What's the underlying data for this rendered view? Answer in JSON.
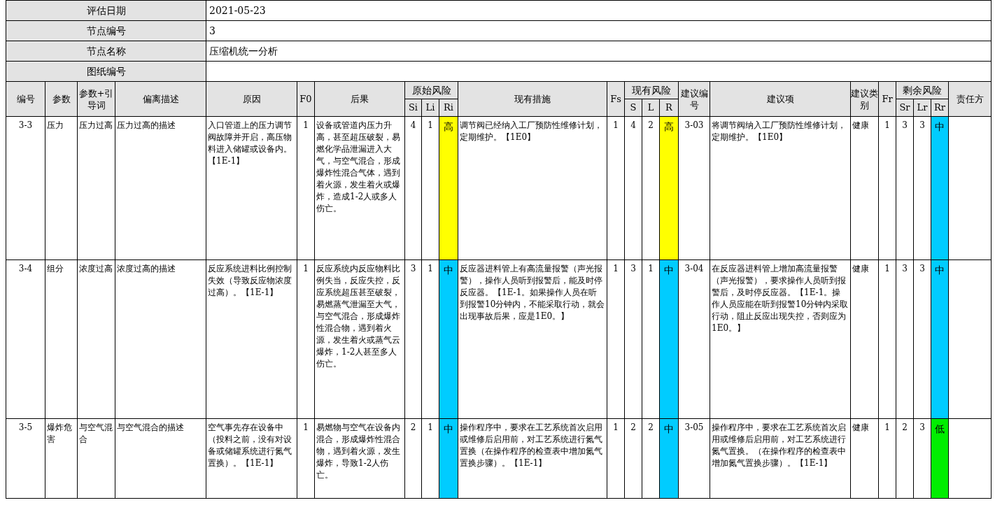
{
  "info": [
    {
      "label": "评估日期",
      "value": "2021-05-23"
    },
    {
      "label": "节点编号",
      "value": "3"
    },
    {
      "label": "节点名称",
      "value": "压缩机统一分析"
    },
    {
      "label": "图纸编号"
    }
  ],
  "columns": [
    {
      "label": "编号"
    },
    {
      "label": "参数"
    },
    {
      "label": "参数+引导词"
    },
    {
      "label": "偏离描述"
    },
    {
      "label": "原因"
    },
    {
      "label": "F0"
    },
    {
      "label": "后果"
    },
    {
      "label": "原始风险",
      "subcolumns": [
        "Si",
        "Li",
        "Ri"
      ]
    },
    {
      "label": "现有措施"
    },
    {
      "label": "Fs"
    },
    {
      "label": "现有风险",
      "subcolumns": [
        "S",
        "L",
        "R"
      ]
    },
    {
      "label": "建议编号"
    },
    {
      "label": "建议项"
    },
    {
      "label": "建议类别"
    },
    {
      "label": "Fr"
    },
    {
      "label": "剩余风险",
      "subcolumns": [
        "Sr",
        "Lr",
        "Rr"
      ]
    },
    {
      "label": "责任方"
    }
  ],
  "rows": [
    {
      "id": "3-3",
      "param": "压力",
      "guide": "压力过高",
      "deviation": "压力过高的描述",
      "cause": "入口管道上的压力调节阀故障并开启，高压物料进入储罐或设备内。【1E-1】",
      "f0": "1",
      "consequence": "设备或管道内压力升高，甚至超压破裂，易燃化学品泄漏进入大气，与空气混合，形成爆炸性混合气体，遇到着火源，发生着火或爆炸，造成1-2人或多人伤亡。",
      "si": "4",
      "li": "1",
      "ri": {
        "text": "高",
        "color": "#ffff00"
      },
      "measures": "调节阀已经纳入工厂预防性维修计划，定期维护。【1E0】",
      "fs": "1",
      "s": "4",
      "l": "2",
      "r": {
        "text": "高",
        "color": "#ffff00"
      },
      "rec_id": "3-03",
      "recommendation": "将调节阀纳入工厂预防性维修计划，定期维护。【1E0】",
      "rec_type": "健康",
      "fr": "1",
      "sr": "3",
      "lr": "3",
      "rr": {
        "text": "中",
        "color": "#00ccff"
      }
    },
    {
      "id": "3-4",
      "param": "组分",
      "guide": "浓度过高",
      "deviation": "浓度过高的描述",
      "cause": "反应系统进料比例控制失效（导致反应物浓度过高）。【1E-1】",
      "f0": "1",
      "consequence": "反应系统内反应物料比例失当，反应失控，反应系统超压甚至破裂，易燃蒸气泄漏至大气，与空气混合，形成爆炸性混合物，遇到着火源，发生着火或蒸气云爆炸，1-2人甚至多人伤亡。",
      "si": "3",
      "li": "1",
      "ri": {
        "text": "中",
        "color": "#00ccff"
      },
      "measures": "反应器进料管上有高流量报警（声光报警），操作人员听到报警后，能及时停反应器。【1E-1。如果操作人员在听到报警10分钟内，不能采取行动，就会出现事故后果，应是1E0。】",
      "fs": "1",
      "s": "3",
      "l": "1",
      "r": {
        "text": "中",
        "color": "#00ccff"
      },
      "rec_id": "3-04",
      "recommendation": "在反应器进料管上增加高流量报警（声光报警），要求操作人员听到报警后，及时停反应器。【1E-1。操作人员应能在听到报警10分钟内采取行动，阻止反应出现失控，否则应为1E0。】",
      "rec_type": "健康",
      "fr": "1",
      "sr": "3",
      "lr": "3",
      "rr": {
        "text": "中",
        "color": "#00ccff"
      }
    },
    {
      "id": "3-5",
      "param": "爆炸危害",
      "guide": "与空气混合",
      "deviation": "与空气混合的描述",
      "cause": "空气事先存在设备中（投料之前，没有对设备或储罐系统进行氮气置换）。【1E-1】",
      "f0": "1",
      "consequence": "易燃物与空气在设备内混合，形成爆炸性混合物，遇到着火源，发生爆炸，导致1-2人伤亡。",
      "si": "2",
      "li": "1",
      "ri": {
        "text": "中",
        "color": "#00ccff"
      },
      "measures": "操作程序中，要求在工艺系统首次启用或维修后启用前，对工艺系统进行氮气置换（在操作程序的检查表中增加氮气置换步骤）。【1E-1】",
      "fs": "1",
      "s": "2",
      "l": "2",
      "r": {
        "text": "中",
        "color": "#00ccff"
      },
      "rec_id": "3-05",
      "recommendation": "操作程序中，要求在工艺系统首次启用或维修后启用前，对工艺系统进行氮气置换。（在操作程序的检查表中增加氮气置换步骤）。【1E-1】",
      "rec_type": "健康",
      "fr": "1",
      "sr": "2",
      "lr": "3",
      "rr": {
        "text": "低",
        "color": "#00ee00"
      }
    }
  ]
}
